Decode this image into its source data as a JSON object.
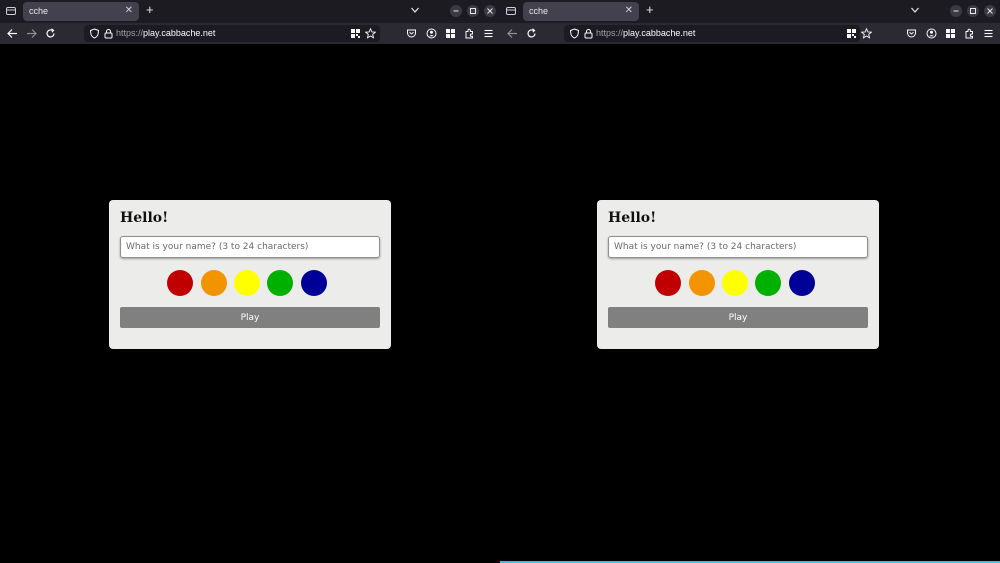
{
  "windows": [
    {
      "tab": {
        "title": "cche"
      },
      "address": {
        "scheme": "https://",
        "host": "play.cabbache.net"
      },
      "card": {
        "title": "Hello!",
        "name_placeholder": "What is your name? (3 to 24 characters)",
        "colors": [
          "#c00000",
          "#f29400",
          "#ffff00",
          "#00b000",
          "#000099"
        ],
        "play_label": "Play"
      }
    },
    {
      "tab": {
        "title": "cche"
      },
      "address": {
        "scheme": "https://",
        "host": "play.cabbache.net"
      },
      "card": {
        "title": "Hello!",
        "name_placeholder": "What is your name? (3 to 24 characters)",
        "colors": [
          "#c00000",
          "#f29400",
          "#ffff00",
          "#00b000",
          "#000099"
        ],
        "play_label": "Play"
      }
    }
  ],
  "icons": {
    "tab_list": "tab-list-icon",
    "new_tab": "plus-icon",
    "tabs_dropdown": "chevron-down-icon",
    "minimize": "minimize-icon",
    "maximize": "maximize-icon",
    "close": "close-icon",
    "back": "back-arrow-icon",
    "forward": "forward-arrow-icon",
    "reload": "reload-icon",
    "shield": "shield-icon",
    "lock": "lock-icon",
    "qr": "qr-code-icon",
    "bookmark": "star-icon",
    "pocket": "pocket-icon",
    "account": "account-icon",
    "extensions_grid": "grid-icon",
    "extensions": "puzzle-icon",
    "menu": "hamburger-menu-icon"
  },
  "theme": {
    "bottom_accent": "#3fbfd8"
  }
}
